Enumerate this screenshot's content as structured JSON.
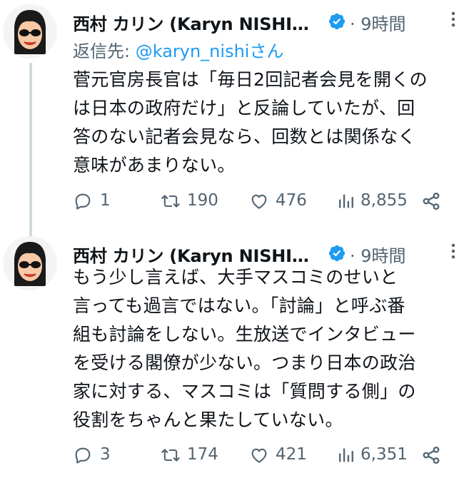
{
  "tweets": [
    {
      "author": {
        "name": "西村 カリン (Karyn NISHI…",
        "verified": true,
        "time": "· 9時間"
      },
      "reply_to": {
        "prefix": "返信先: ",
        "handle": "@karyn_nishiさん"
      },
      "text": "菅元官房長官は「毎日2回記者会見を開くの\nは日本の政府だけ」と反論していたが、回\n答のない記者会見なら、回数とは関係なく\n意味があまりない。",
      "stats": {
        "replies": "1",
        "retweets": "190",
        "likes": "476",
        "views": "8,855"
      }
    },
    {
      "author": {
        "name": "西村 カリン (Karyn NISHI…",
        "verified": true,
        "time": "· 9時間"
      },
      "text": "もう少し言えば、大手マスコミのせいと\n言っても過言ではない。「討論」と呼ぶ番\n組も討論をしない。生放送でインタビュー\nを受ける閣僚が少ない。つまり日本の政治\n家に対する、マスコミは「質問する側」の\n役割をちゃんと果たしていない。",
      "stats": {
        "replies": "3",
        "retweets": "174",
        "likes": "421",
        "views": "6,351"
      }
    }
  ],
  "colors": {
    "text": "#0f1419",
    "secondary": "#536471",
    "link": "#1d9bf0",
    "verified": "#1d9bf0",
    "thread_line": "#cfd9de"
  },
  "icons": {
    "verified": "verified-badge-icon",
    "more": "more-dots-icon",
    "reply": "reply-bubble-icon",
    "retweet": "retweet-icon",
    "like": "heart-icon",
    "views": "views-bar-chart-icon",
    "share": "share-icon",
    "avatar": "avatar-cartoon-sunglasses"
  }
}
